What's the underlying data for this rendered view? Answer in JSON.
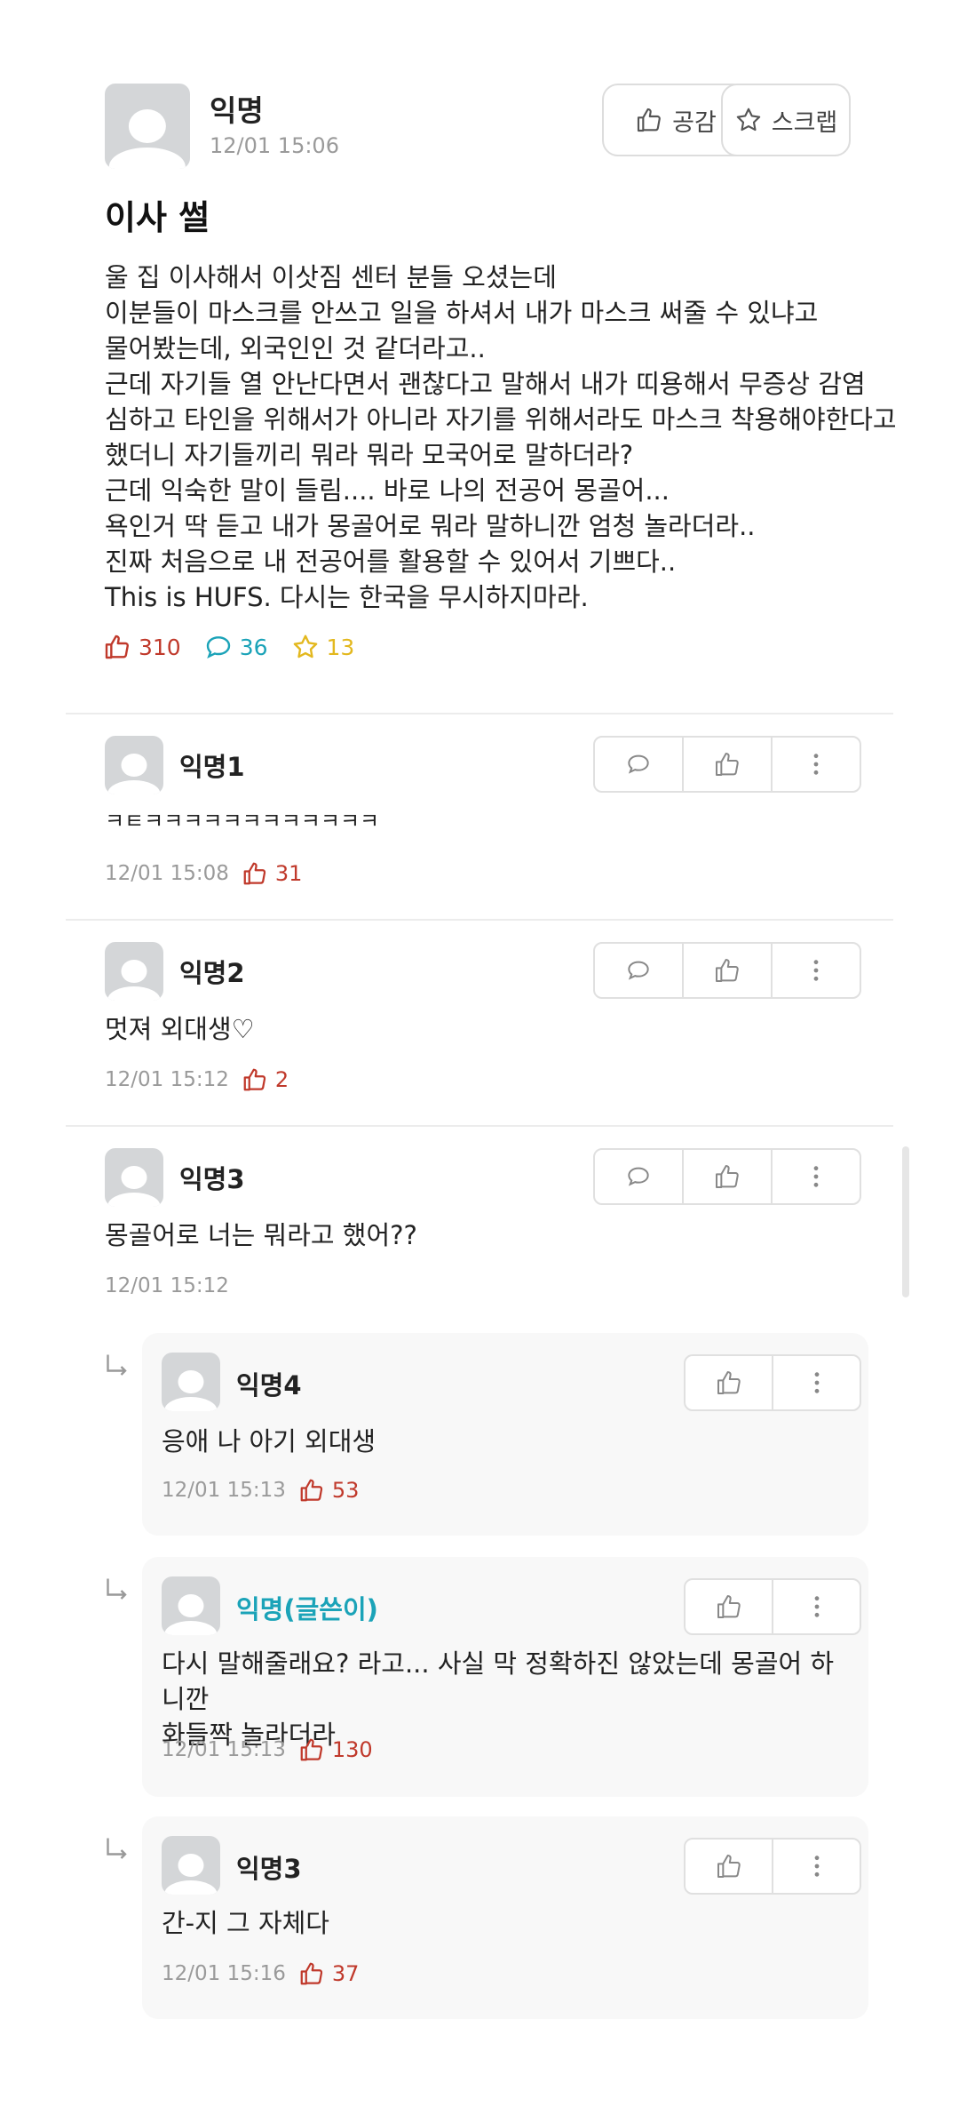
{
  "post": {
    "author": "익명",
    "datetime": "12/01 15:06",
    "title": "이사 썰",
    "body_lines": [
      "울 집 이사해서 이삿짐 센터 분들 오셨는데",
      "이분들이 마스크를 안쓰고 일을 하셔서 내가 마스크 써줄 수 있냐고",
      "물어봤는데, 외국인인 것 같더라고..",
      "근데 자기들 열 안난다면서 괜찮다고 말해서 내가 띠용해서 무증상 감염",
      "심하고 타인을 위해서가 아니라 자기를 위해서라도 마스크 착용해야한다고",
      "했더니 자기들끼리 뭐라 뭐라 모국어로 말하더라?",
      "근데 익숙한 말이 들림.... 바로 나의 전공어 몽골어...",
      "욕인거 딱 듣고 내가 몽골어로 뭐라 말하니깐 엄청 놀라더라..",
      "진짜 처음으로 내 전공어를 활용할 수 있어서 기쁘다..",
      "This is HUFS. 다시는 한국을 무시하지마라."
    ],
    "buttons": {
      "like": "공감",
      "scrap": "스크랩"
    },
    "stats": {
      "likes": "310",
      "comments": "36",
      "scraps": "13"
    }
  },
  "comments": [
    {
      "author": "익명1",
      "text": "ㅋㅌㅋㅋㅋㅋㅋㅋㅋㅋㅋㅋㅋㅋ",
      "datetime": "12/01 15:08",
      "likes": "31"
    },
    {
      "author": "익명2",
      "text": "멋져 외대생♡",
      "datetime": "12/01 15:12",
      "likes": "2"
    },
    {
      "author": "익명3",
      "text": "몽골어로 너는 뭐라고 했어??",
      "datetime": "12/01 15:12",
      "likes": ""
    }
  ],
  "replies": [
    {
      "author": "익명4",
      "text_lines": [
        "응애 나 아기 외대생"
      ],
      "datetime": "12/01 15:13",
      "likes": "53"
    },
    {
      "author": "익명(글쓴이)",
      "text_lines": [
        "다시 말해줄래요? 라고... 사실 막 정확하진 않았는데 몽골어 하니깐",
        "화들짝 놀라더라"
      ],
      "datetime": "12/01 15:13",
      "likes": "130"
    },
    {
      "author": "익명3",
      "text_lines": [
        "간-지 그 자체다"
      ],
      "datetime": "12/01 15:16",
      "likes": "37"
    }
  ],
  "colors": {
    "like": "#c0392b",
    "comment": "#1ba3b8",
    "scrap": "#e3b81e",
    "op_author": "#1ba3b8",
    "divider": "#ececec"
  }
}
